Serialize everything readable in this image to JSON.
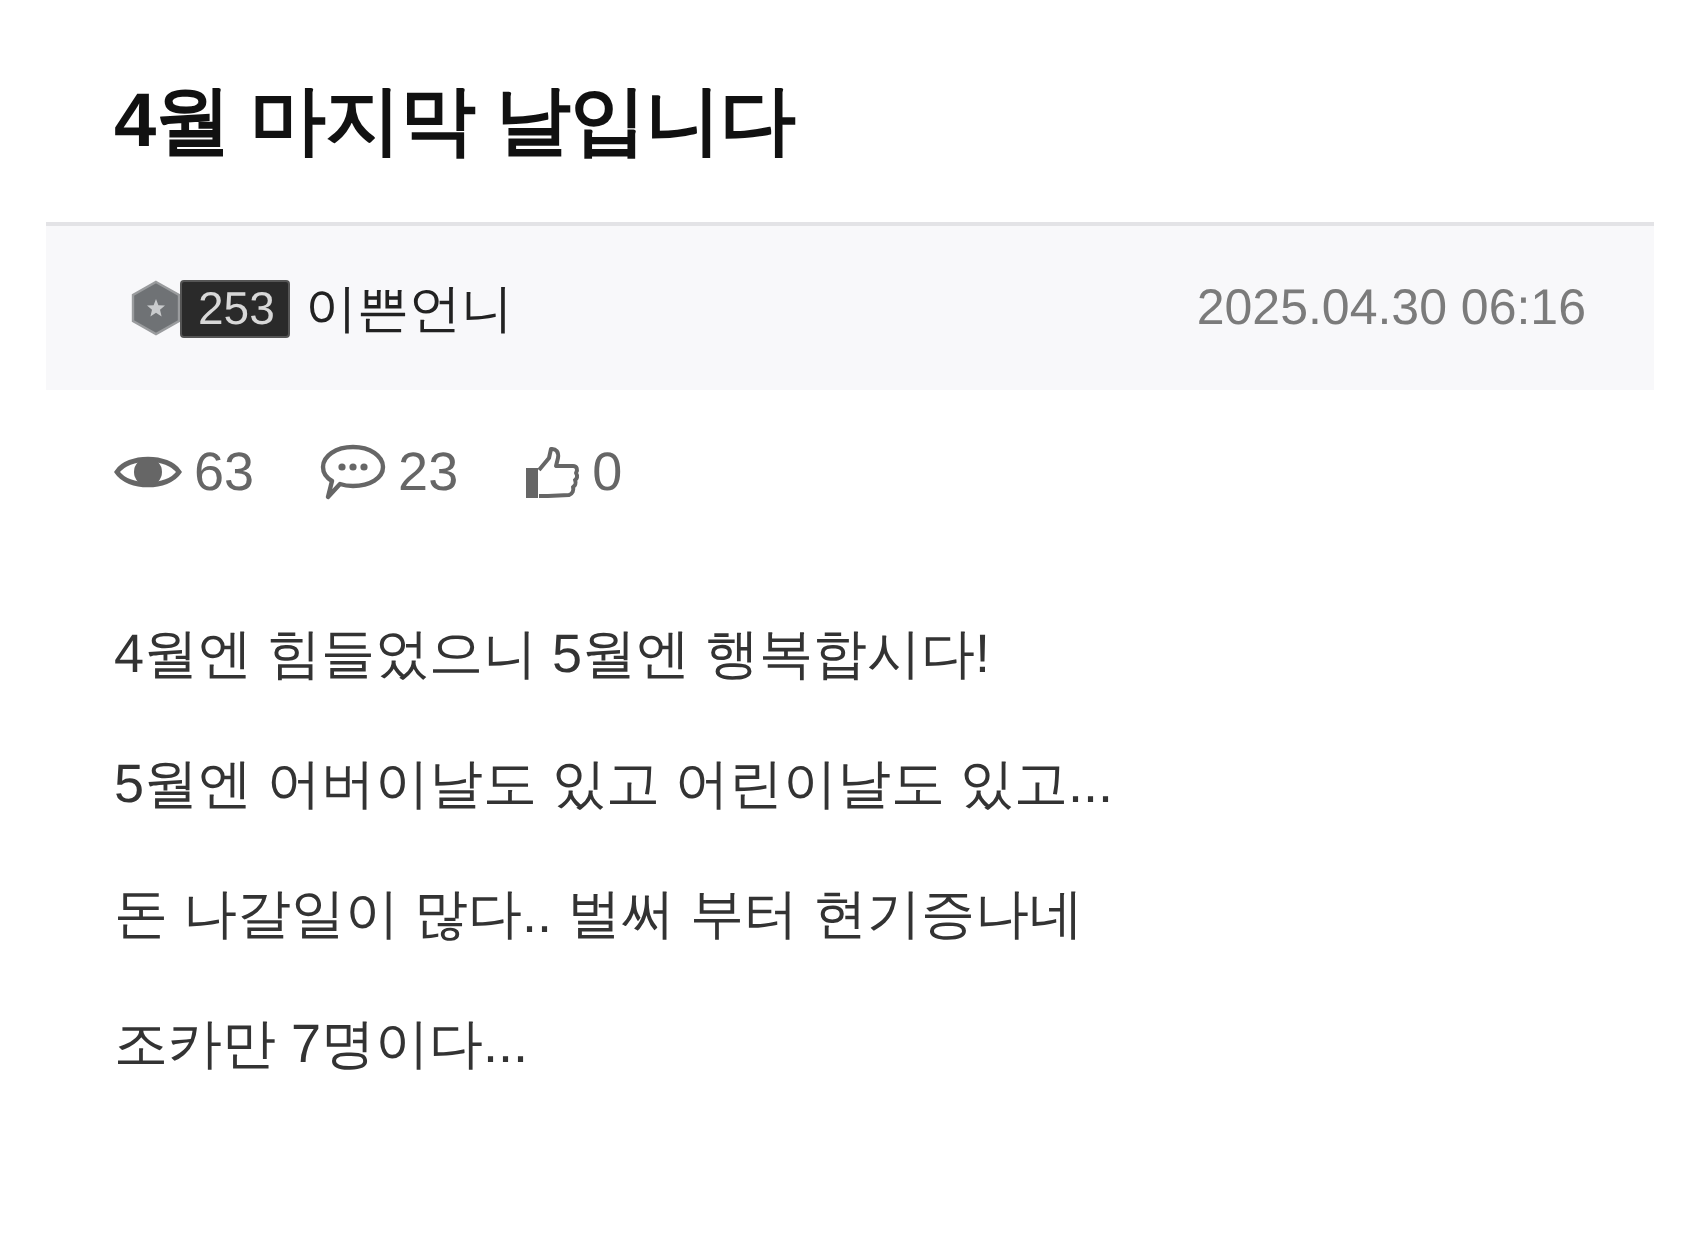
{
  "post": {
    "title": "4월 마지막 날입니다"
  },
  "author": {
    "badge_number": "253",
    "name": "이쁜언니",
    "date": "2025.04.30 06:16"
  },
  "stats": [
    {
      "kind": "views",
      "count": "63"
    },
    {
      "kind": "comments",
      "count": "23"
    },
    {
      "kind": "likes",
      "count": "0"
    }
  ],
  "body": [
    "4월엔 힘들었으니 5월엔 행복합시다!",
    "5월엔 어버이날도 있고 어린이날도 있고...",
    "돈 나갈일이 많다.. 벌써 부터 현기증나네",
    "조카만 7명이다..."
  ]
}
